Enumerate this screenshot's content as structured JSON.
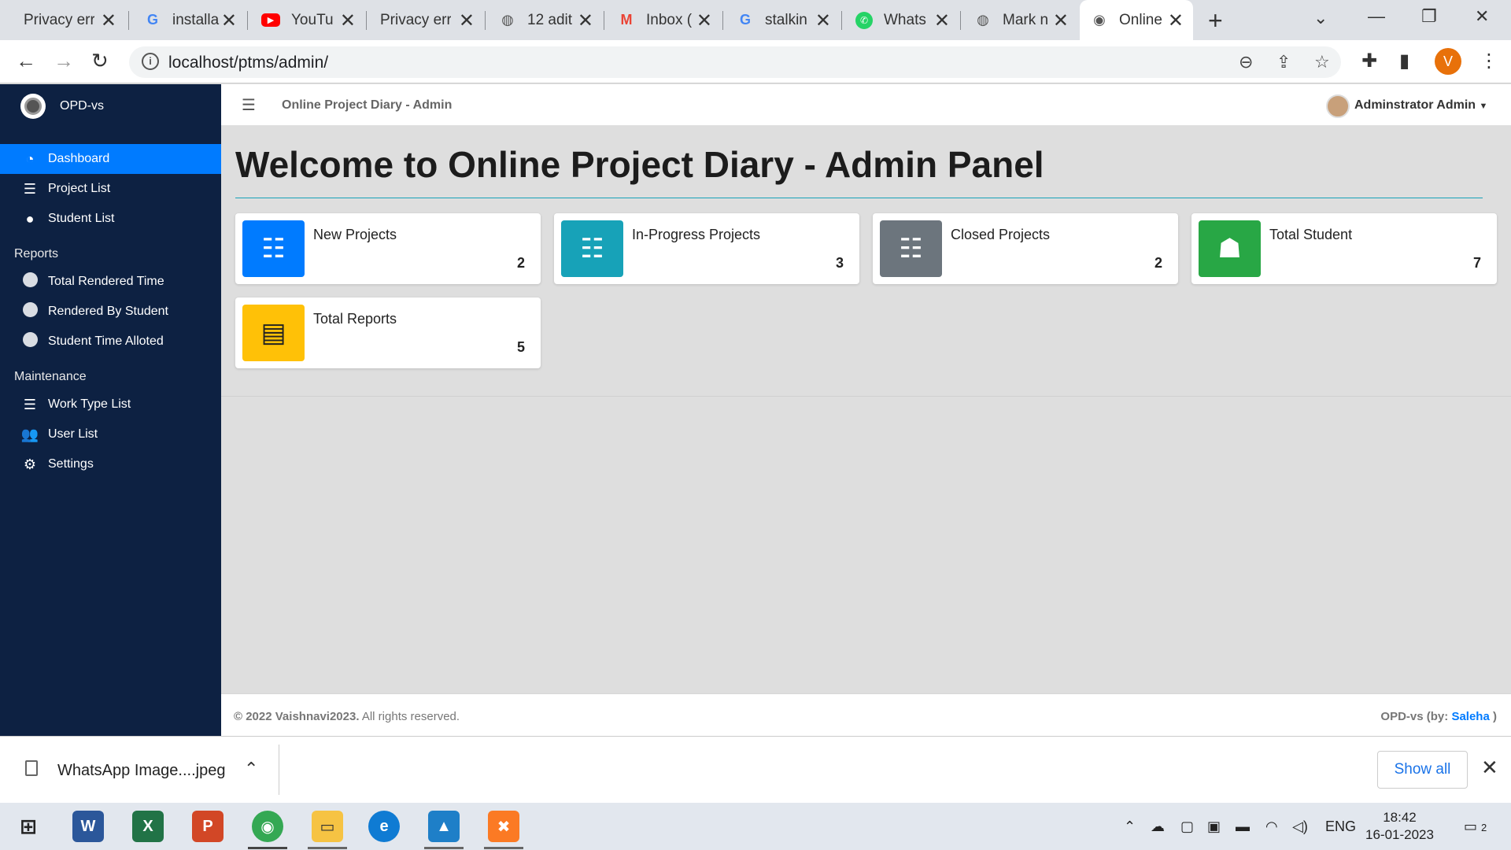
{
  "browser": {
    "tabs": [
      {
        "title": "Privacy erro",
        "icon": "globe-icon"
      },
      {
        "title": "installa",
        "icon": "google-icon"
      },
      {
        "title": "YouTu",
        "icon": "youtube-icon"
      },
      {
        "title": "Privacy erro",
        "icon": "none"
      },
      {
        "title": "12 adit",
        "icon": "globe-icon"
      },
      {
        "title": "Inbox (",
        "icon": "gmail-icon"
      },
      {
        "title": "stalkin",
        "icon": "google-icon"
      },
      {
        "title": "Whats",
        "icon": "whatsapp-icon"
      },
      {
        "title": "Mark n",
        "icon": "globe-icon"
      },
      {
        "title": "Online",
        "icon": "site-icon",
        "active": true
      }
    ],
    "url": "localhost/ptms/admin/",
    "profile_initial": "V"
  },
  "sidebar": {
    "brand": "OPD-vs",
    "items": [
      {
        "label": "Dashboard",
        "icon": "dashboard-icon",
        "active": true
      },
      {
        "label": "Project List",
        "icon": "list-icon"
      },
      {
        "label": "Student List",
        "icon": "user-icon"
      }
    ],
    "reports_header": "Reports",
    "reports": [
      {
        "label": "Total Rendered Time"
      },
      {
        "label": "Rendered By Student"
      },
      {
        "label": "Student Time Alloted"
      }
    ],
    "maintenance_header": "Maintenance",
    "maintenance": [
      {
        "label": "Work Type List",
        "icon": "list-icon"
      },
      {
        "label": "User List",
        "icon": "users-icon"
      },
      {
        "label": "Settings",
        "icon": "gears-icon"
      }
    ]
  },
  "topbar": {
    "title": "Online Project Diary - Admin",
    "user": "Adminstrator Admin"
  },
  "main": {
    "heading": "Welcome to Online Project Diary - Admin Panel",
    "cards": [
      {
        "label": "New Projects",
        "value": "2",
        "color": "#007bff",
        "icon": "checklist-icon"
      },
      {
        "label": "In-Progress Projects",
        "value": "3",
        "color": "#17a2b8",
        "icon": "checklist-icon"
      },
      {
        "label": "Closed Projects",
        "value": "2",
        "color": "#6c757d",
        "icon": "checklist-icon"
      },
      {
        "label": "Total Student",
        "value": "7",
        "color": "#28a745",
        "icon": "user-tie-icon"
      },
      {
        "label": "Total Reports",
        "value": "5",
        "color": "#ffc107",
        "icon": "file-icon"
      }
    ]
  },
  "footer": {
    "copyright": "© 2022 Vaishnavi2023.",
    "rights": "All rights reserved.",
    "credit_prefix": "OPD-vs (by:",
    "credit_name": "Saleha",
    "credit_suffix": ")"
  },
  "downloads": {
    "file": "WhatsApp Image....jpeg",
    "show_all": "Show all"
  },
  "taskbar": {
    "lang": "ENG",
    "time": "18:42",
    "date": "16-01-2023",
    "notifications": "2"
  }
}
